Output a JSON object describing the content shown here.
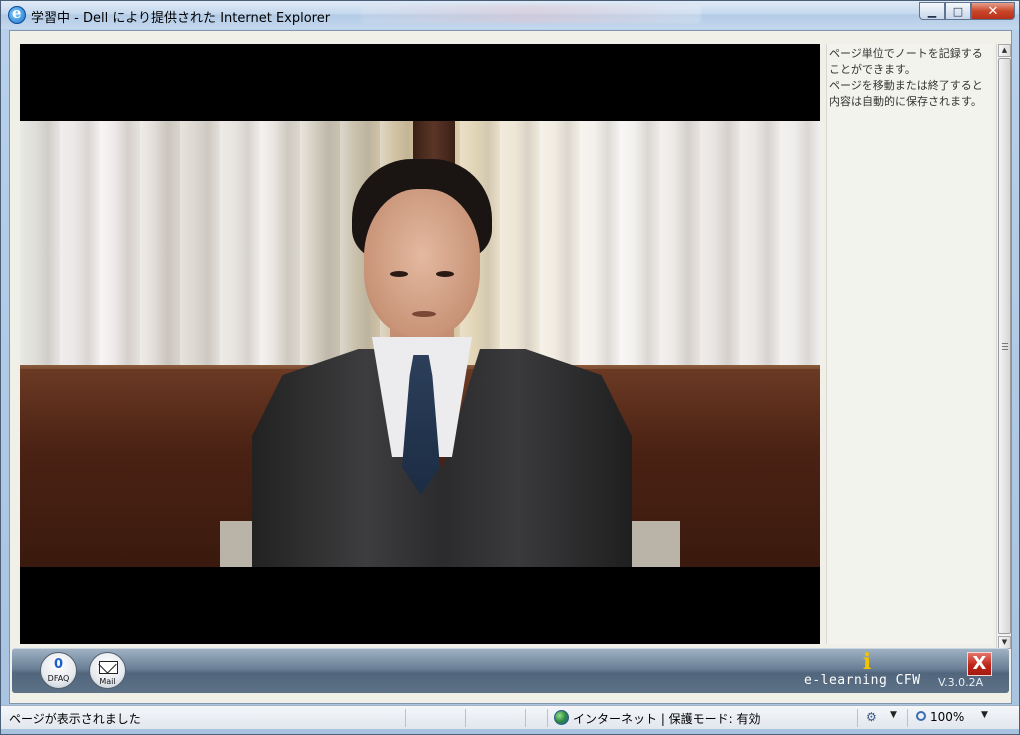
{
  "window": {
    "title": "学習中 - Dell により提供された Internet Explorer",
    "minimize_label": "▁",
    "maximize_label": "□",
    "close_label": "✕"
  },
  "notes": {
    "lines": [
      "ページ単位でノートを記録する",
      "ことができます。",
      "ページを移動または終了すると",
      "内容は自動的に保存されます。"
    ]
  },
  "toolbar": {
    "dfaq_count": "0",
    "dfaq_label": "DFAQ",
    "mail_label": "Mail",
    "brand": "e-learning CFW",
    "version": "V.3.0.2A",
    "info_label": "i",
    "exit_label": "X"
  },
  "statusbar": {
    "message": "ページが表示されました",
    "zone": "インターネット | 保護モード: 有効",
    "zoom": "100%"
  },
  "scrollbar": {
    "up_label": "▲",
    "down_label": "▼"
  }
}
